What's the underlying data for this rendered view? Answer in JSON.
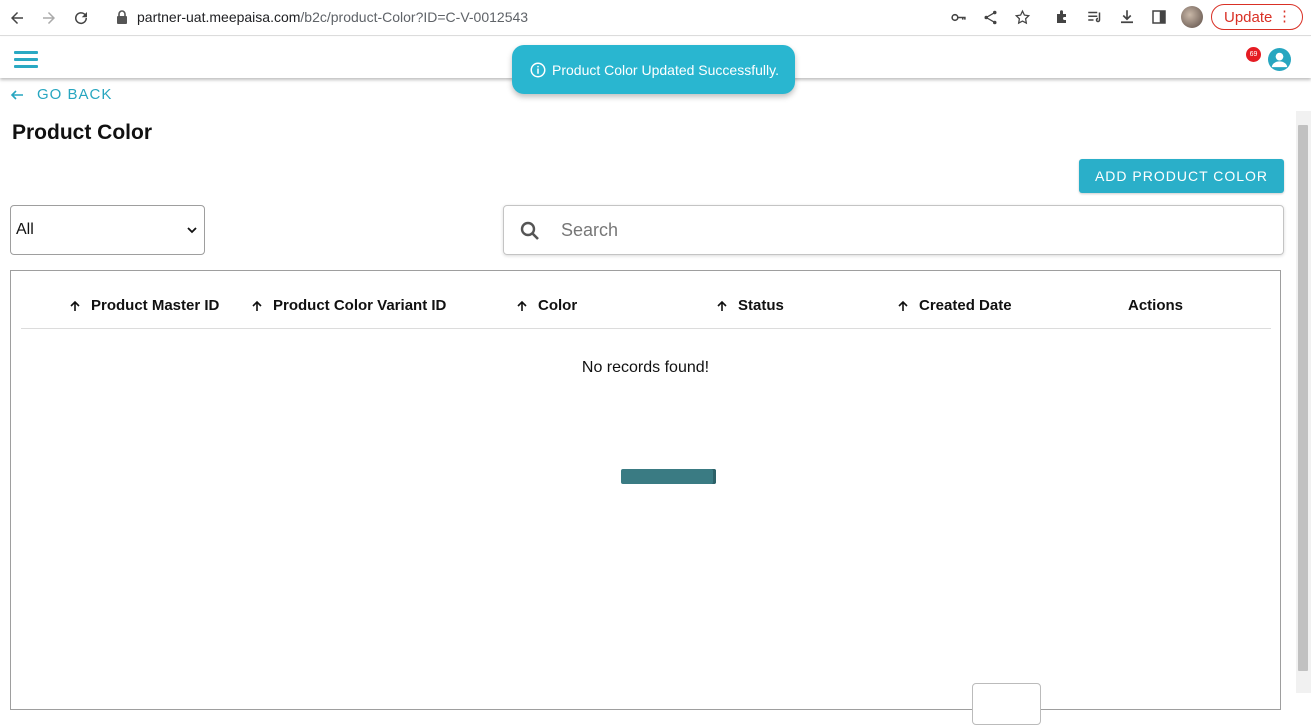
{
  "browser": {
    "url_host": "partner-uat.meepaisa.com",
    "url_path": "/b2c/product-Color?ID=C-V-0012543",
    "update_label": "Update"
  },
  "header": {
    "notification_count": "69"
  },
  "toast": {
    "message": "Product Color Updated Successfully."
  },
  "page": {
    "go_back_label": "GO BACK",
    "title": "Product Color",
    "add_button_label": "ADD PRODUCT COLOR"
  },
  "filters": {
    "status_selected": "All",
    "search_placeholder": "Search"
  },
  "table": {
    "columns": [
      {
        "label": "Product Master ID",
        "sortable": true
      },
      {
        "label": "Product Color Variant ID",
        "sortable": true
      },
      {
        "label": "Color",
        "sortable": true
      },
      {
        "label": "Status",
        "sortable": true
      },
      {
        "label": "Created Date",
        "sortable": true
      },
      {
        "label": "Actions",
        "sortable": false
      }
    ],
    "empty_message": "No records found!"
  },
  "colors": {
    "accent": "#2aafc9",
    "toast_bg": "#29b6d0",
    "badge": "#e51c23",
    "loader": "#3a7b83"
  }
}
